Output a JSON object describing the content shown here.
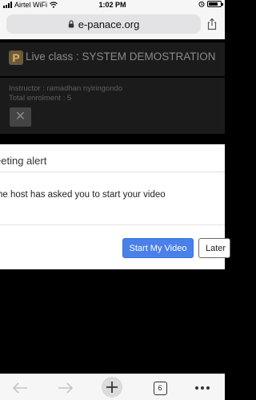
{
  "status_bar": {
    "carrier": "Airtel WiFi",
    "time": "1:02 PM"
  },
  "browser": {
    "url": "e-panace.org"
  },
  "page": {
    "title": "Live class : SYSTEM DEMOSTRATION",
    "logo_letter": "P",
    "instructor": "Instructor : ramadhan nyiringondo",
    "enrolment": "Total enrolment : 5",
    "close_glyph": "✕"
  },
  "modal": {
    "title": "eeting alert",
    "message": "he host has asked you to start your video",
    "primary_button": "Start My Video",
    "secondary_button": "Later"
  },
  "toolbar": {
    "tab_count": "6"
  },
  "colors": {
    "primary_button": "#4a80ea",
    "overlay": "#000000"
  }
}
